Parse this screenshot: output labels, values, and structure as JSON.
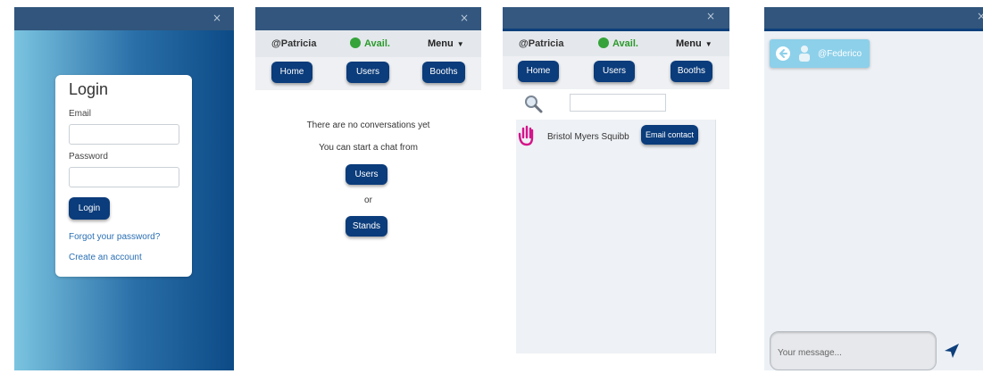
{
  "login_panel": {
    "close": "×",
    "title": "Login",
    "email_label": "Email",
    "password_label": "Password",
    "login_button": "Login",
    "forgot_link": "Forgot your password?",
    "create_link": "Create an account"
  },
  "header": {
    "handle": "@Patricia",
    "status": "Avail.",
    "menu": "Menu",
    "close": "×"
  },
  "nav": {
    "home": "Home",
    "users": "Users",
    "booths": "Booths"
  },
  "conversations_panel": {
    "empty": "There are no conversations yet",
    "start": "You can start a chat from",
    "users_button": "Users",
    "or": "or",
    "stands_button": "Stands"
  },
  "search_panel": {
    "result_name": "Bristol Myers Squibb",
    "email_contact": "Email contact"
  },
  "chat_panel": {
    "close": "×",
    "contact": "@Federico",
    "message_placeholder": "Your message..."
  }
}
